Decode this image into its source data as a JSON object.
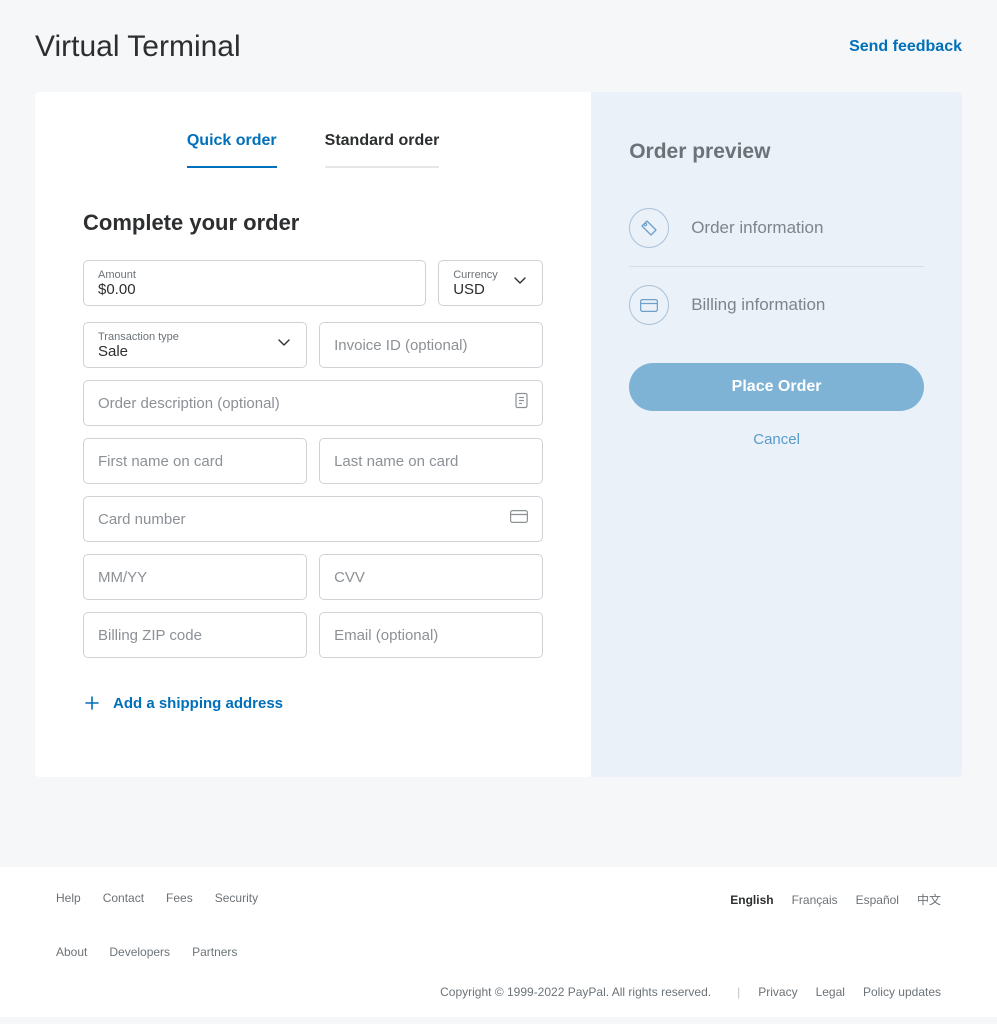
{
  "header": {
    "title": "Virtual Terminal",
    "feedback": "Send feedback"
  },
  "tabs": {
    "quick": "Quick order",
    "standard": "Standard order"
  },
  "form": {
    "section_title": "Complete your order",
    "amount_label": "Amount",
    "amount_value": "$0.00",
    "currency_label": "Currency",
    "currency_value": "USD",
    "txn_type_label": "Transaction type",
    "txn_type_value": "Sale",
    "invoice_placeholder": "Invoice ID (optional)",
    "description_placeholder": "Order description (optional)",
    "first_name_placeholder": "First name on card",
    "last_name_placeholder": "Last name on card",
    "card_number_placeholder": "Card number",
    "expiry_placeholder": "MM/YY",
    "cvv_placeholder": "CVV",
    "zip_placeholder": "Billing ZIP code",
    "email_placeholder": "Email (optional)",
    "add_shipping": "Add a shipping address"
  },
  "preview": {
    "title": "Order preview",
    "order_info": "Order information",
    "billing_info": "Billing information",
    "place_order": "Place Order",
    "cancel": "Cancel"
  },
  "footer": {
    "links": {
      "help": "Help",
      "contact": "Contact",
      "fees": "Fees",
      "security": "Security",
      "about": "About",
      "developers": "Developers",
      "partners": "Partners"
    },
    "langs": {
      "english": "English",
      "francais": "Français",
      "espanol": "Español",
      "chinese": "中文"
    },
    "copyright": "Copyright © 1999-2022 PayPal. All rights reserved.",
    "privacy": "Privacy",
    "legal": "Legal",
    "policy_updates": "Policy updates"
  }
}
